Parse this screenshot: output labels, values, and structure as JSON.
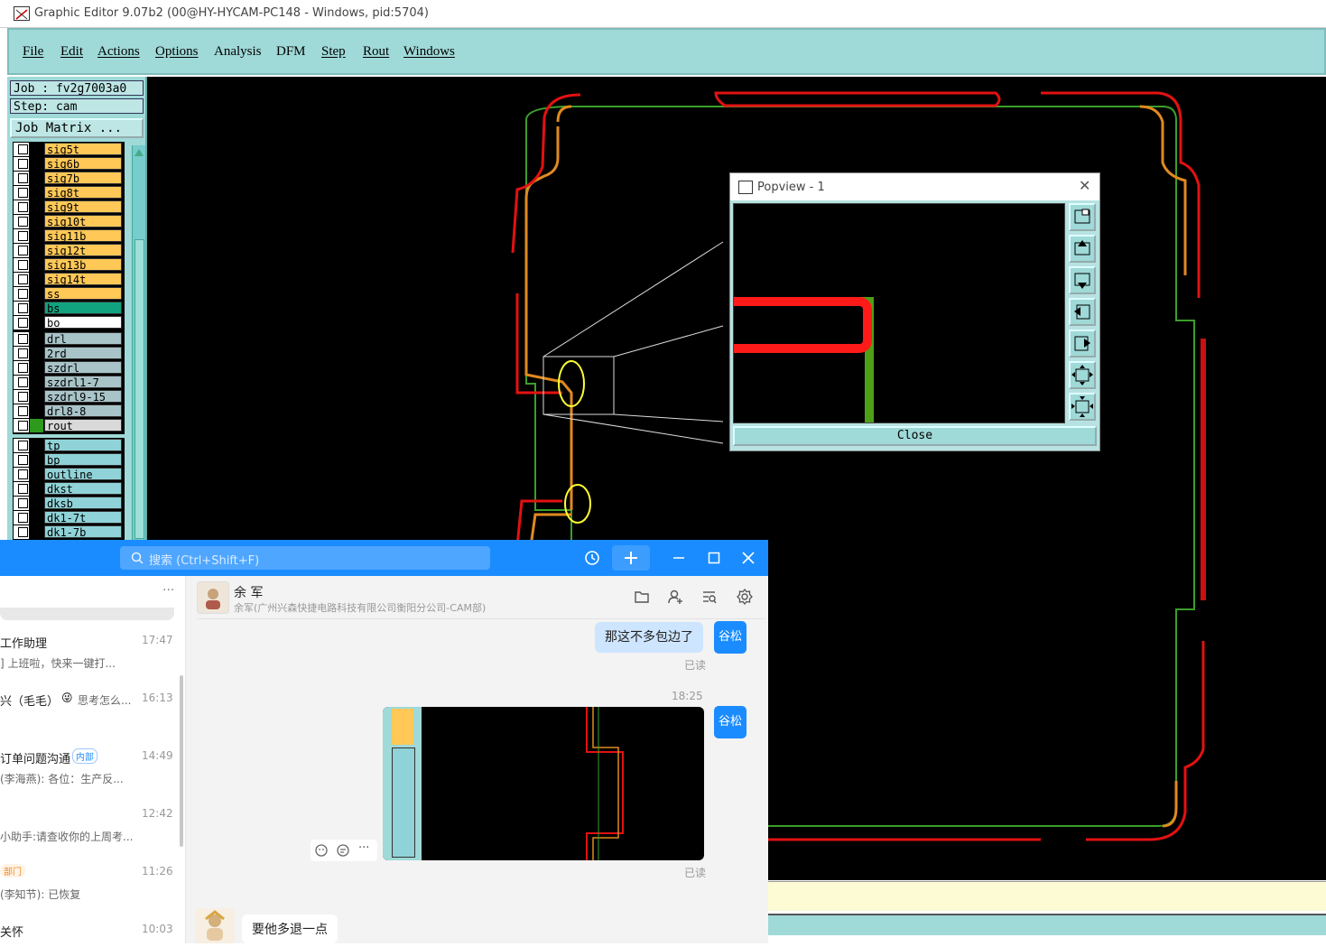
{
  "window": {
    "title": "Graphic Editor 9.07b2 (00@HY-HYCAM-PC148 - Windows, pid:5704)"
  },
  "menu": {
    "items": [
      "File",
      "Edit",
      "Actions",
      "Options",
      "Analysis",
      "DFM",
      "Step",
      "Rout",
      "Windows"
    ]
  },
  "job": {
    "job_label": "Job : fv2g7003a0",
    "step_label": "Step: cam",
    "matrix_button": "Job Matrix ..."
  },
  "layers": {
    "group1": [
      {
        "name": "sig5t",
        "color": "#ffc857"
      },
      {
        "name": "sig6b",
        "color": "#ffc857"
      },
      {
        "name": "sig7b",
        "color": "#ffc857"
      },
      {
        "name": "sig8t",
        "color": "#ffc857"
      },
      {
        "name": "sig9t",
        "color": "#ffc857"
      },
      {
        "name": "sig10t",
        "color": "#ffc857"
      },
      {
        "name": "sig11b",
        "color": "#ffc857"
      },
      {
        "name": "sig12t",
        "color": "#ffc857"
      },
      {
        "name": "sig13b",
        "color": "#ffc857"
      },
      {
        "name": "sig14t",
        "color": "#ffc857"
      },
      {
        "name": "ss",
        "color": "#ffc857"
      },
      {
        "name": "bs",
        "color": "#11a37f"
      },
      {
        "name": "bo",
        "color": "#ffffff"
      }
    ],
    "group2": [
      {
        "name": "drl",
        "color": "#a9c4c9"
      },
      {
        "name": "2rd",
        "color": "#a9c4c9"
      },
      {
        "name": "szdrl",
        "color": "#a9c4c9"
      },
      {
        "name": "szdrl1-7",
        "color": "#a9c4c9"
      },
      {
        "name": "szdrl9-15",
        "color": "#a9c4c9"
      },
      {
        "name": "drl8-8",
        "color": "#a9c4c9"
      },
      {
        "name": "rout",
        "color": "#d9d9d9"
      }
    ],
    "group3": [
      {
        "name": "tp",
        "color": "#8fd3d8"
      },
      {
        "name": "bp",
        "color": "#8fd3d8"
      },
      {
        "name": "outline",
        "color": "#8fd3d8"
      },
      {
        "name": "dkst",
        "color": "#8fd3d8"
      },
      {
        "name": "dksb",
        "color": "#8fd3d8"
      },
      {
        "name": "dk1-7t",
        "color": "#8fd3d8"
      },
      {
        "name": "dk1-7b",
        "color": "#8fd3d8"
      }
    ]
  },
  "popview": {
    "title": "Popview - 1",
    "close_label": "Close",
    "tool_icons": [
      "zoom-fit-icon",
      "pan-up-icon",
      "pan-down-icon",
      "pan-left-icon",
      "pan-right-icon",
      "zoom-in-icon",
      "zoom-out-icon"
    ]
  },
  "chat": {
    "search_placeholder": "搜索 (Ctrl+Shift+F)",
    "list_items": [
      {
        "name": "工作助理",
        "time": "17:47",
        "msg": "] 上班啦，快来一键打..."
      },
      {
        "name": "兴（毛毛）",
        "time": "16:13",
        "msg": "思考怎么..."
      },
      {
        "name": "订单问题沟通",
        "tag": "内部",
        "time": "14:49",
        "msg": "(李海燕): 各位：生产反..."
      },
      {
        "name": "",
        "time": "12:42",
        "msg": "小助手:请查收你的上周考..."
      },
      {
        "name": "",
        "tag": "部门",
        "time": "11:26",
        "msg": "(李知节): 已恢复"
      },
      {
        "name": "关怀",
        "time": "10:03",
        "msg": ""
      }
    ],
    "contact_name": "余 军",
    "contact_sub": "余军(广州兴森快捷电路科技有限公司衡阳分公司-CAM部)",
    "messages": {
      "msg1": "那这不多包边了",
      "sender": "谷松",
      "read1": "已读",
      "time2": "18:25",
      "read2": "已读",
      "reply": "要他多退一点"
    },
    "more_label": "···"
  }
}
